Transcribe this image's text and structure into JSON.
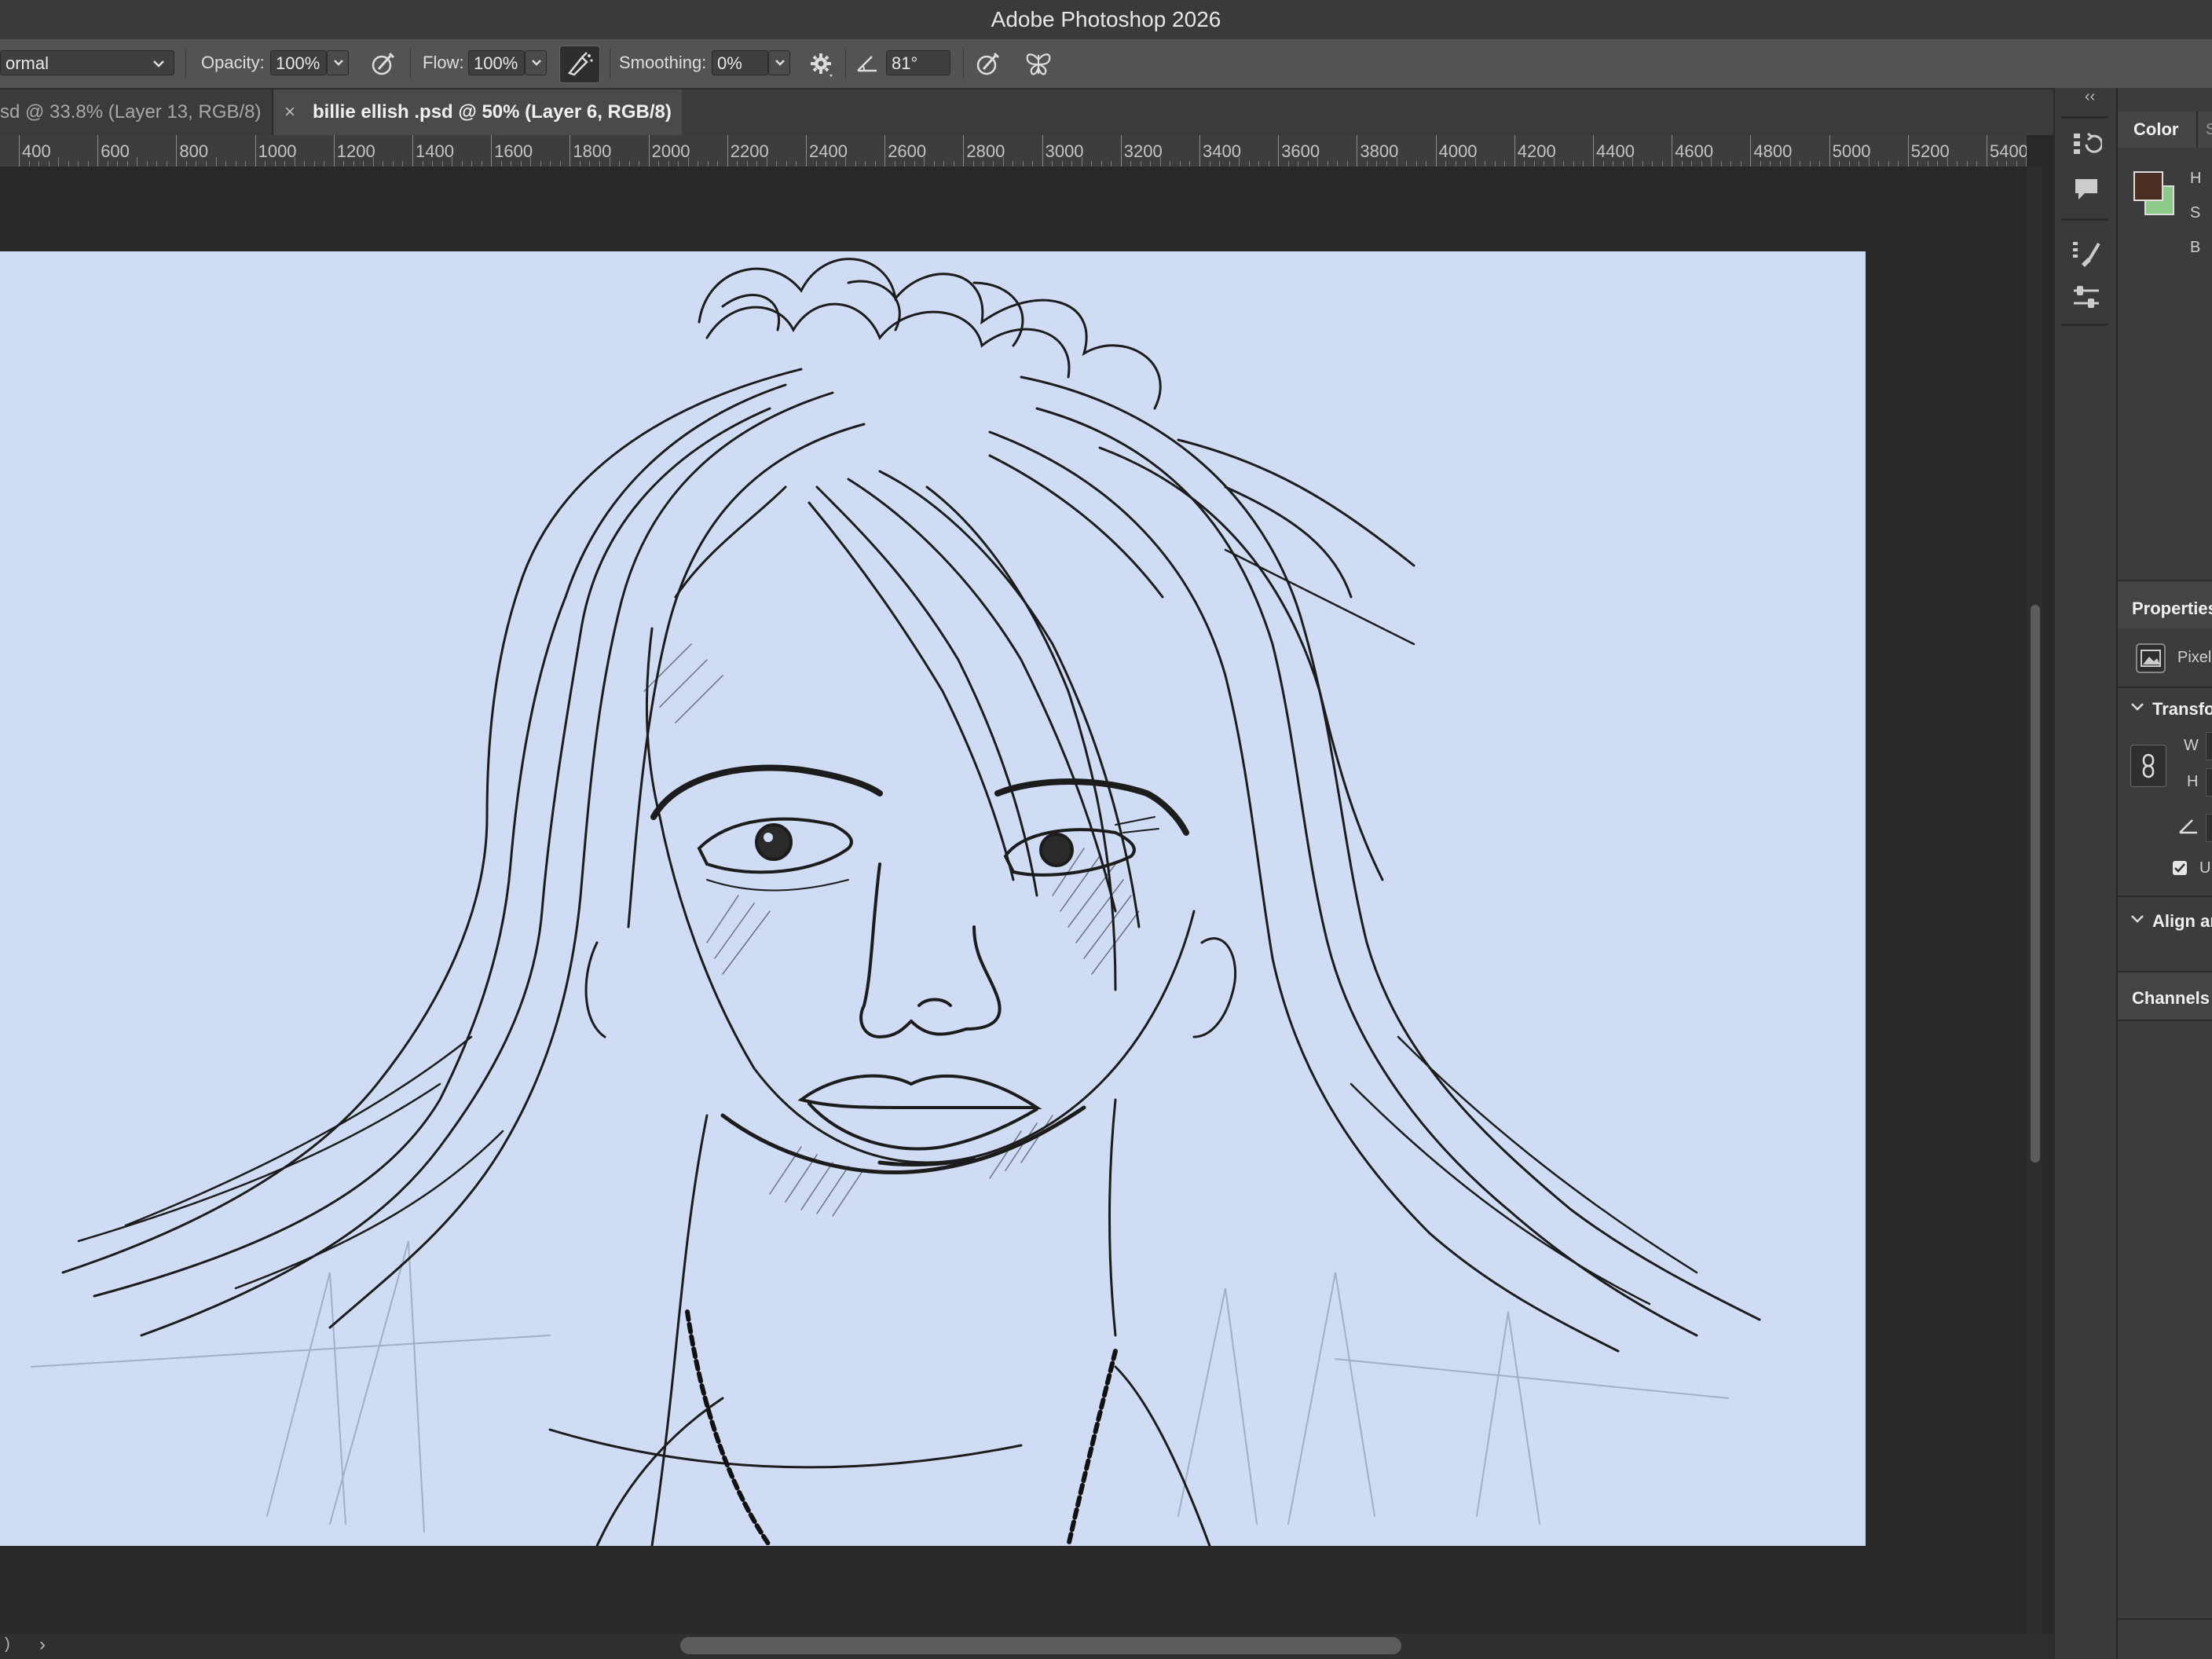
{
  "app": {
    "title": "Adobe Photoshop 2026"
  },
  "options": {
    "mode_value": "ormal",
    "opacity_label": "Opacity:",
    "opacity_value": "100%",
    "flow_label": "Flow:",
    "flow_value": "100%",
    "smoothing_label": "Smoothing:",
    "smoothing_value": "0%",
    "angle_value": "81°"
  },
  "tabs": [
    {
      "label": "sd @ 33.8% (Layer 13, RGB/8)",
      "active": false
    },
    {
      "label": "billie ellish .psd @ 50% (Layer 6, RGB/8)",
      "active": true
    }
  ],
  "tab_close_glyph": "×",
  "ruler": {
    "ticks": [
      "400",
      "600",
      "800",
      "1000",
      "1200",
      "1400",
      "1600",
      "1800",
      "2000",
      "2200",
      "2400",
      "2600",
      "2800",
      "3000",
      "3200",
      "3400",
      "3600",
      "3800",
      "4000",
      "4200",
      "4400",
      "4600",
      "4800",
      "5000",
      "5200",
      "5400"
    ]
  },
  "canvas": {
    "background": "#d0dcf3",
    "subject": "pencil-sketch-portrait"
  },
  "panels": {
    "collapse_glyph": "‹‹",
    "color_tab": "Color",
    "second_tab_initial": "S",
    "color_channels": [
      "H",
      "S",
      "B"
    ],
    "foreground_color": "#4a2e22",
    "background_color": "#8ecb8a",
    "properties_title": "Properties",
    "pixel_layer_label": "Pixel",
    "transform_title": "Transfo",
    "w_label": "W",
    "h_label": "H",
    "checkbox_label": "U",
    "align_title": "Align ar",
    "channels_title": "Channels"
  },
  "bottom": {
    "status_left": ")",
    "arrow": "›"
  }
}
